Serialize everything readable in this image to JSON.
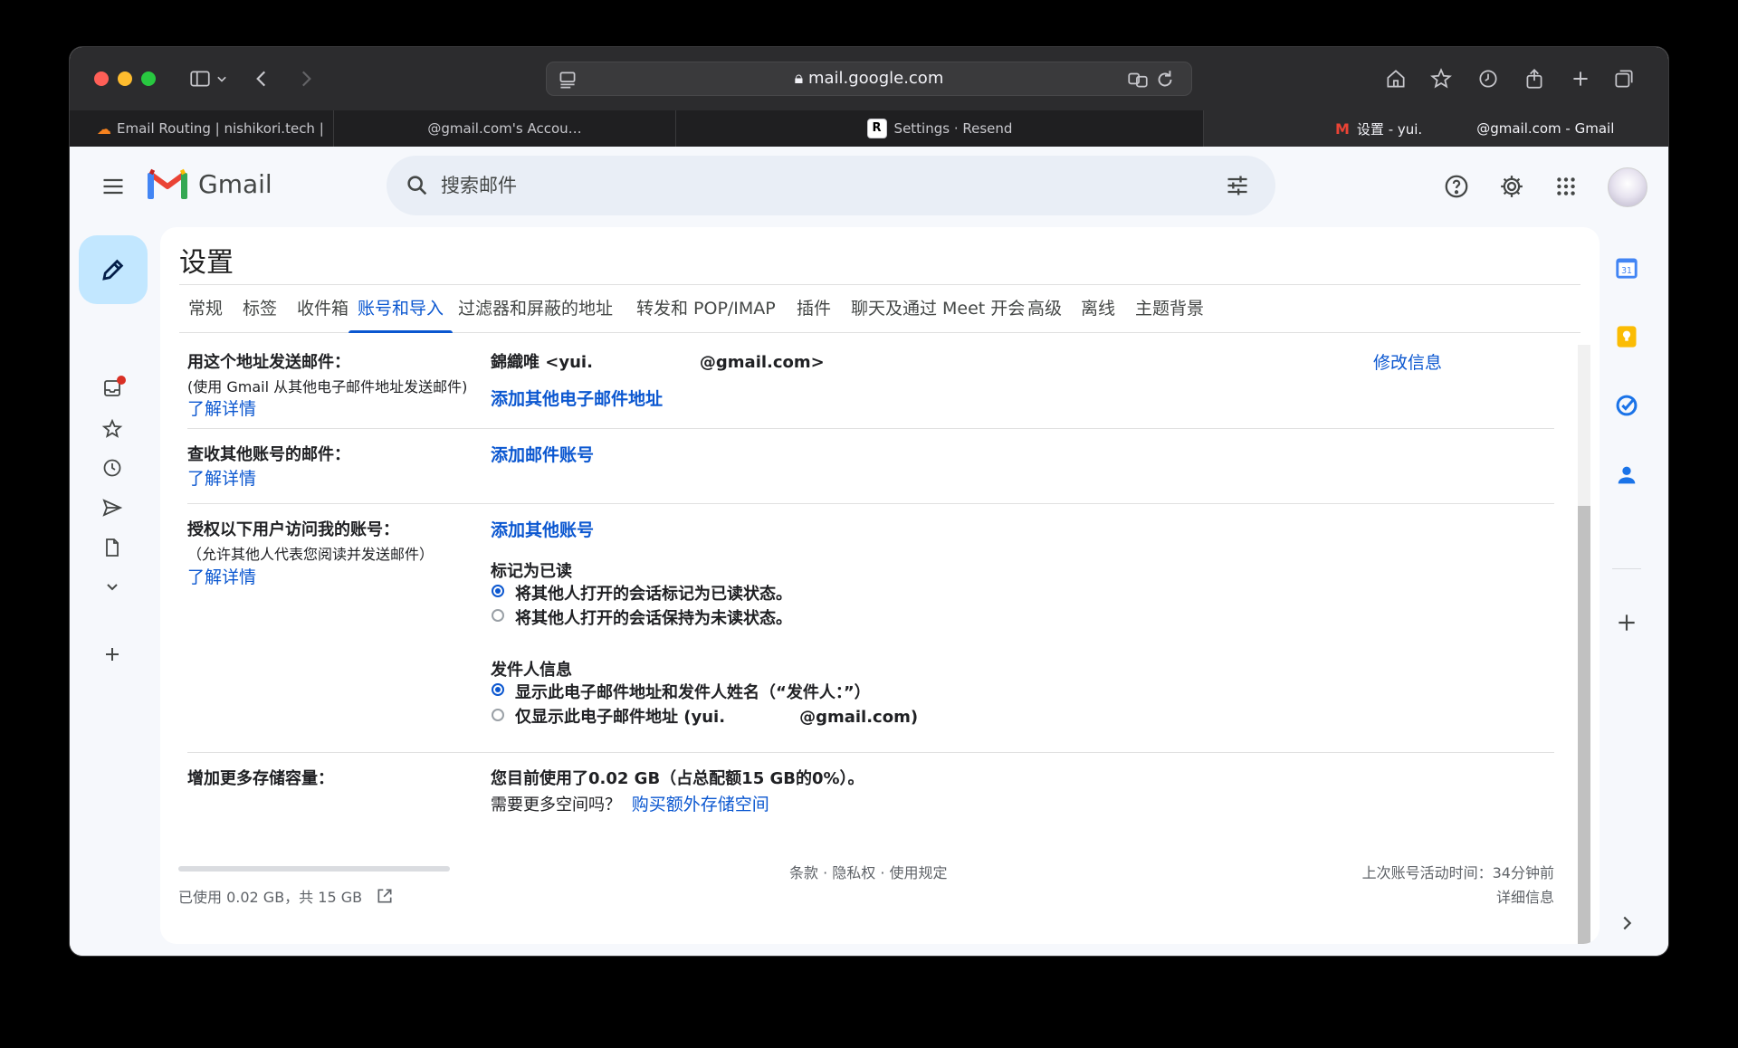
{
  "browser": {
    "url": "mail.google.com",
    "tabs": [
      {
        "label": "Email Routing | nishikori.tech |",
        "icon": "cloudflare-icon"
      },
      {
        "label": "@gmail.com's Accou…",
        "icon": "google-icon"
      },
      {
        "label": "Settings · Resend",
        "icon": "resend-icon",
        "badge": "R"
      },
      {
        "label": "设置 - yui.",
        "label2": "@gmail.com - Gmail",
        "icon": "gmail-icon"
      }
    ]
  },
  "gmail": {
    "logo_text": "Gmail",
    "search_placeholder": "搜索邮件",
    "page_title": "设置",
    "settings_tabs": [
      {
        "label": "常规"
      },
      {
        "label": "标签"
      },
      {
        "label": "收件箱"
      },
      {
        "label": "账号和导入"
      },
      {
        "label": "过滤器和屏蔽的地址"
      },
      {
        "label": "转发和 POP/IMAP"
      },
      {
        "label": "插件"
      },
      {
        "label": "聊天及通过 Meet 开会"
      },
      {
        "label": "高级"
      },
      {
        "label": "离线"
      },
      {
        "label": "主题背景"
      }
    ],
    "send_as": {
      "label": "用这个地址发送邮件：",
      "sub": "(使用 Gmail 从其他电子邮件地址发送邮件)",
      "learn": "了解详情",
      "name_part": "錦織唯 <yui.",
      "addr_part": "@gmail.com>",
      "edit": "修改信息",
      "add": "添加其他电子邮件地址"
    },
    "check_mail": {
      "label": "查收其他账号的邮件：",
      "learn": "了解详情",
      "add": "添加邮件账号"
    },
    "grant": {
      "label": "授权以下用户访问我的账号：",
      "sub": "（允许其他人代表您阅读并发送邮件）",
      "learn": "了解详情",
      "add": "添加其他账号",
      "mark_title": "标记为已读",
      "mark_opt1": "将其他人打开的会话标记为已读状态。",
      "mark_opt2": "将其他人打开的会话保持为未读状态。",
      "sender_title": "发件人信息",
      "sender_opt1": "显示此电子邮件地址和发件人姓名（“发件人：”）",
      "sender_opt2_a": "仅显示此电子邮件地址 (yui.",
      "sender_opt2_b": "@gmail.com)"
    },
    "storage": {
      "label": "增加更多存储容量：",
      "usage": "您目前使用了0.02 GB（占总配额15 GB的0%）。",
      "need": "需要更多空间吗？",
      "buy": "购买额外存储空间"
    },
    "footer": {
      "used": "已使用 0.02 GB，共 15 GB",
      "links": "条款 · 隐私权 · 使用规定",
      "last_activity": "上次账号活动时间：34分钟前",
      "details": "详细信息"
    }
  },
  "colors": {
    "accent": "#0b57d0",
    "compose": "#c2e7ff",
    "bg": "#f6f8fc"
  }
}
